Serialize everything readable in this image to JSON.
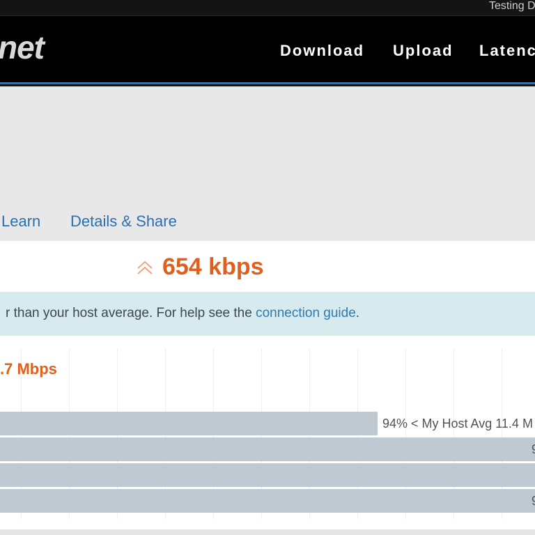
{
  "topbar": {
    "text": "Testing D"
  },
  "header": {
    "logo_text": "net",
    "nav": [
      {
        "label": "Download"
      },
      {
        "label": "Upload"
      },
      {
        "label": "Latenc"
      }
    ]
  },
  "tabs": [
    {
      "label": "Learn"
    },
    {
      "label": "Details & Share"
    }
  ],
  "result": {
    "upload_speed": "654 kbps",
    "arrow_icon": "upload-arrow-icon",
    "accent_color": "#e05f1c"
  },
  "info": {
    "text": "r than your host average. For help see the ",
    "link": "connection guide",
    "suffix": "."
  },
  "comparison": {
    "download_speed": ".7 Mbps",
    "bars": [
      {
        "label": "94% < My Host Avg 11.4 M",
        "fill": 0.94
      },
      {
        "label": "9",
        "fill": 1.0
      },
      {
        "label": "",
        "fill": 1.0
      },
      {
        "label": "9",
        "fill": 1.0
      }
    ]
  }
}
